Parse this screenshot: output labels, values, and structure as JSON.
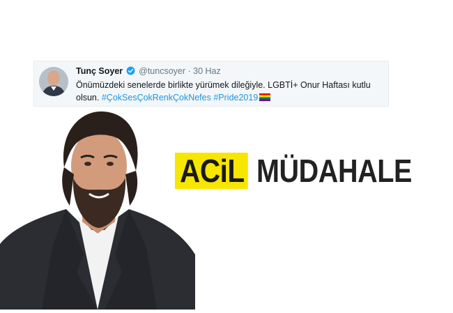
{
  "tweet": {
    "author_name": "Tunç Soyer",
    "handle": "@tuncsoyer",
    "separator": " · ",
    "date": "30 Haz",
    "text": "Önümüzdeki senelerde birlikte yürümek dileğiyle. LGBTİ+ Onur Haftası kutlu olsun. ",
    "hashtags": [
      "#ÇokSesÇokRenkÇokNefes",
      "#Pride2019"
    ]
  },
  "headline": {
    "part1": "ACiL",
    "part2": "MÜDAHALE",
    "highlight_color": "#f7e600"
  },
  "icons": {
    "verified": "verified-badge-icon",
    "flag": "rainbow-flag-icon"
  }
}
